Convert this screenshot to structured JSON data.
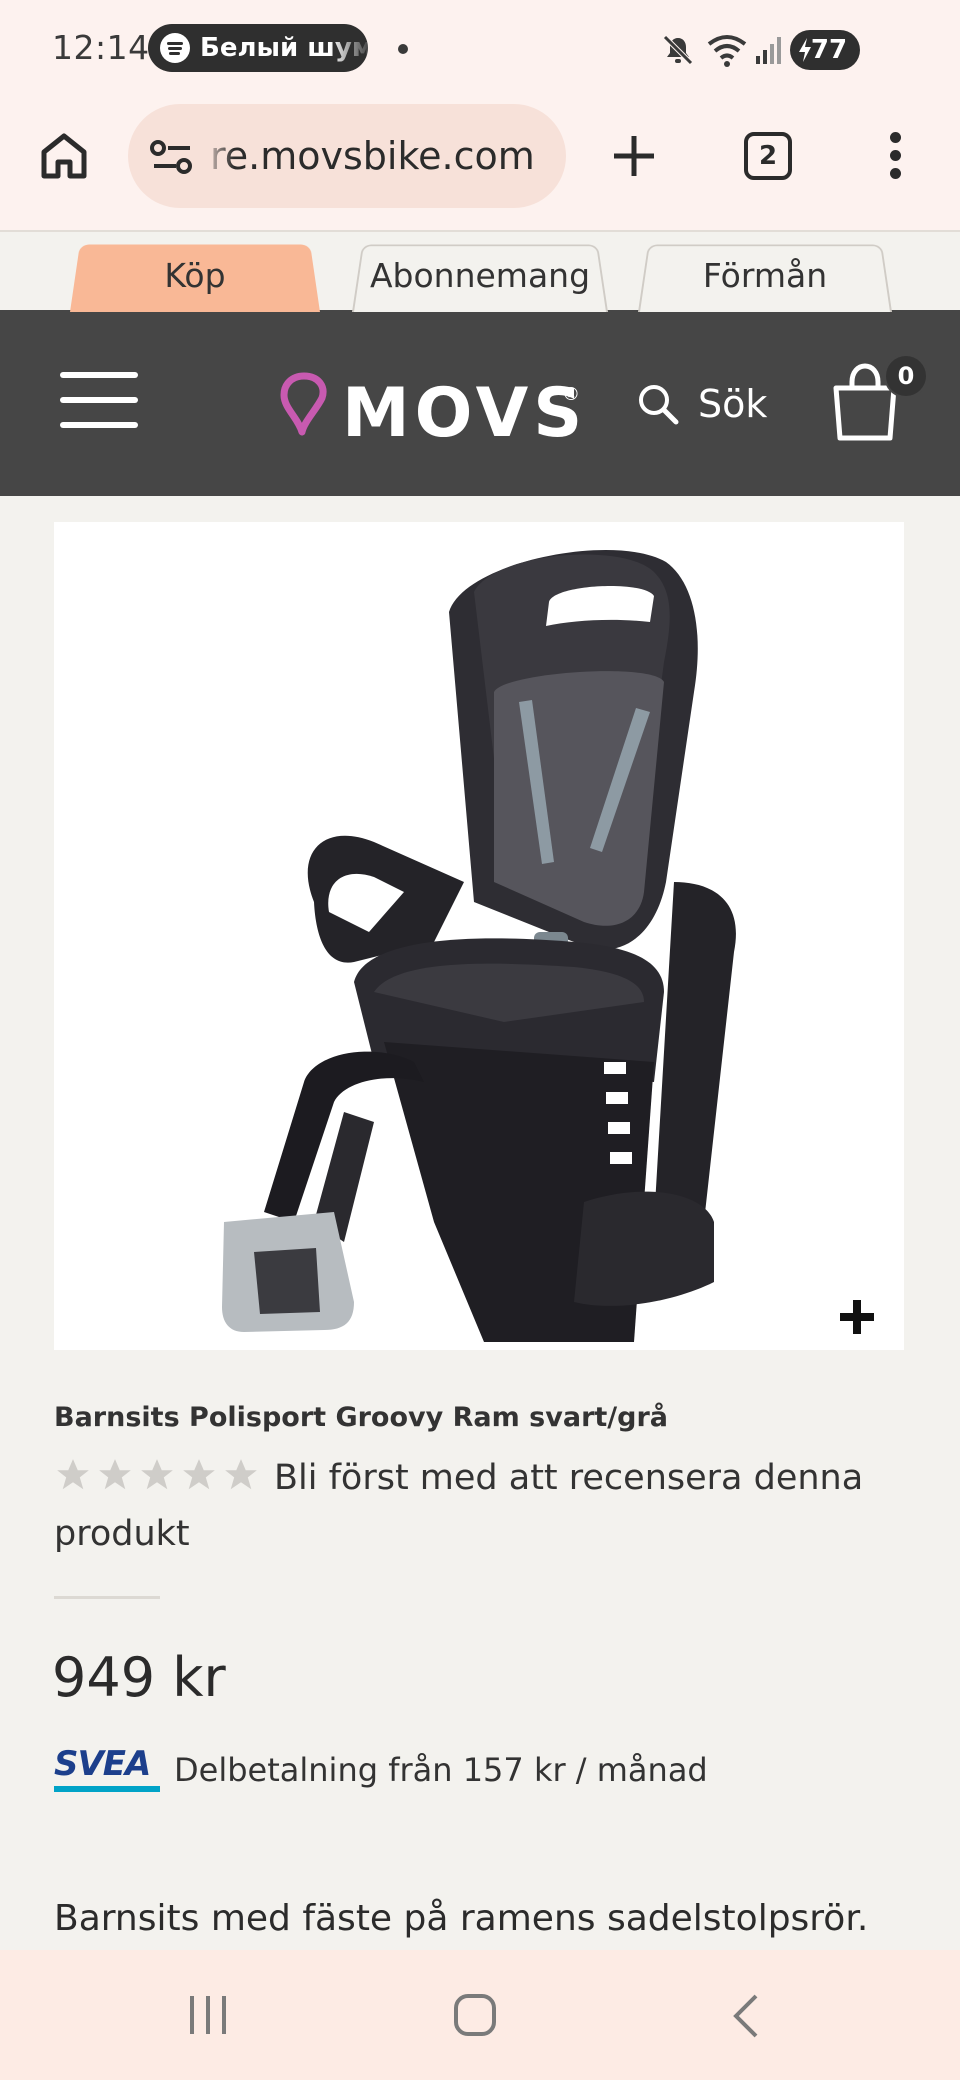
{
  "status_bar": {
    "time": "12:14",
    "media_label": "Белый шум",
    "battery": "77"
  },
  "browser": {
    "url": "re.movsbike.com",
    "tab_count": "2"
  },
  "site_tabs": [
    {
      "label": "Köp",
      "active": true
    },
    {
      "label": "Abonnemang",
      "active": false
    },
    {
      "label": "Förmån",
      "active": false
    }
  ],
  "header": {
    "logo_text": "MOVS",
    "logo_mark": "®",
    "search_label": "Sök",
    "cart_count": "0"
  },
  "product": {
    "title": "Barnsits Polisport Groovy Ram svart/grå",
    "rating_stars": 0,
    "review_prompt": "Bli först med att recensera denna produkt",
    "price": "949 kr",
    "payment_provider": "SVEA",
    "installment_text": "Delbetalning från 157 kr / månad",
    "description": "Barnsits med fäste på ramens sadelstolpsrör."
  },
  "colors": {
    "accent_tab": "#f9b896",
    "header_bg": "#464646",
    "logo_pin": "#c85ab0",
    "svea_blue": "#1c3f8c",
    "svea_teal": "#00a3c7"
  }
}
